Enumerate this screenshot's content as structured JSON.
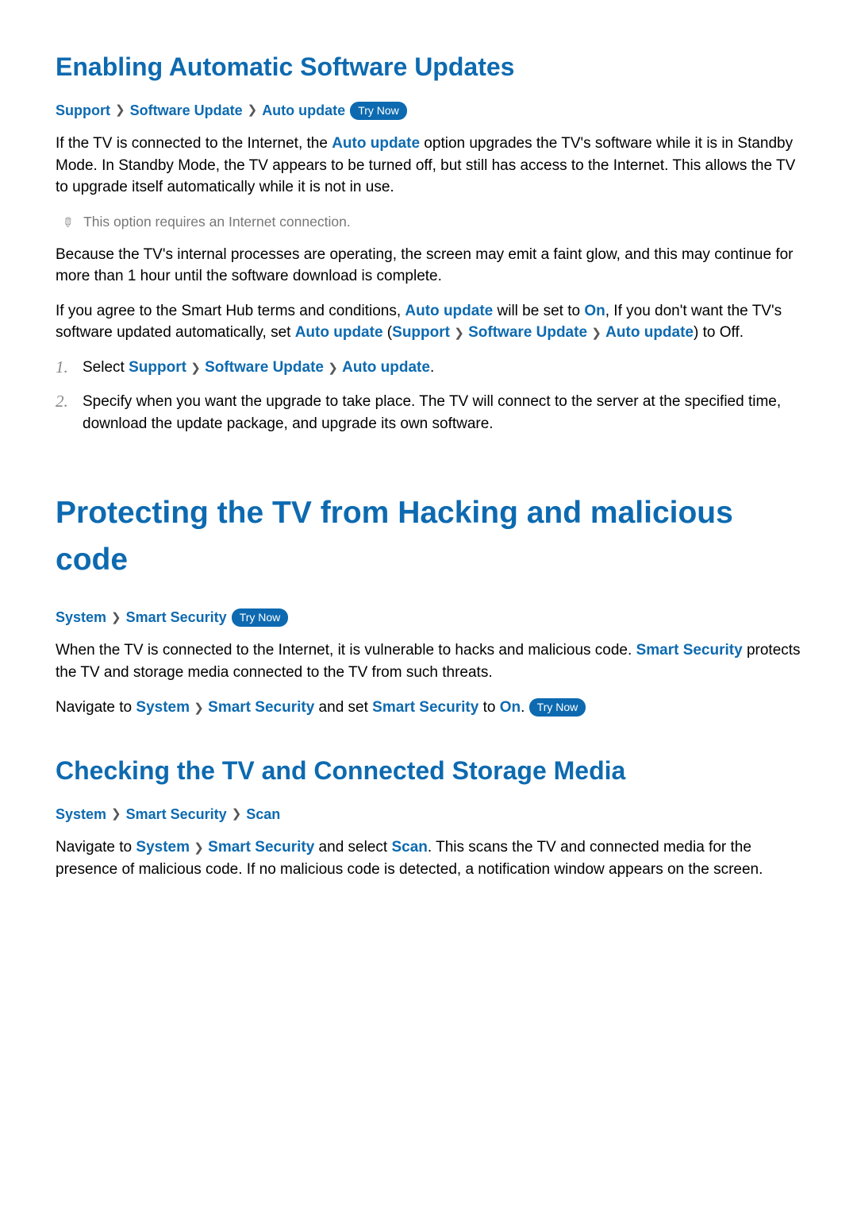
{
  "tryNow": "Try Now",
  "sec1": {
    "heading": "Enabling Automatic Software Updates",
    "crumbs": [
      "Support",
      "Software Update",
      "Auto update"
    ],
    "p1a": "If the TV is connected to the Internet, the ",
    "p1_auto": "Auto update",
    "p1b": " option upgrades the TV's software while it is in Standby Mode. In Standby Mode, the TV appears to be turned off, but still has access to the Internet. This allows the TV to upgrade itself automatically while it is not in use.",
    "note": "This option requires an Internet connection.",
    "p2": "Because the TV's internal processes are operating, the screen may emit a faint glow, and this may continue for more than 1 hour until the software download is complete.",
    "p3a": "If you agree to the Smart Hub terms and conditions, ",
    "p3_auto": "Auto update",
    "p3b": " will be set to ",
    "p3_on": "On",
    "p3c": ", If you don't want the TV's software updated automatically, set ",
    "p3_auto2": "Auto update",
    "p3d": " (",
    "p3_support": "Support",
    "p3_sw": "Software Update",
    "p3_auto3": "Auto update",
    "p3e": ") to Off.",
    "step1_pre": "Select ",
    "step1_crumbs": [
      "Support",
      "Software Update",
      "Auto update"
    ],
    "step1_post": ".",
    "step2": "Specify when you want the upgrade to take place. The TV will connect to the server at the specified time, download the update package, and upgrade its own software."
  },
  "sec2": {
    "heading": "Protecting the TV from Hacking and malicious code",
    "crumbs": [
      "System",
      "Smart Security"
    ],
    "p1a": "When the TV is connected to the Internet, it is vulnerable to hacks and malicious code. ",
    "p1_ss": "Smart Security",
    "p1b": " protects the TV and storage media connected to the TV from such threats.",
    "p2a": "Navigate to ",
    "p2_sys": "System",
    "p2_ss": "Smart Security",
    "p2b": " and set ",
    "p2_ss2": "Smart Security",
    "p2c": " to ",
    "p2_on": "On",
    "p2d": ". "
  },
  "sec3": {
    "heading": "Checking the TV and Connected Storage Media",
    "crumbs": [
      "System",
      "Smart Security",
      "Scan"
    ],
    "p1a": "Navigate to ",
    "p1_sys": "System",
    "p1_ss": "Smart Security",
    "p1b": " and select ",
    "p1_scan": "Scan",
    "p1c": ". This scans the TV and connected media for the presence of malicious code. If no malicious code is detected, a notification window appears on the screen."
  }
}
